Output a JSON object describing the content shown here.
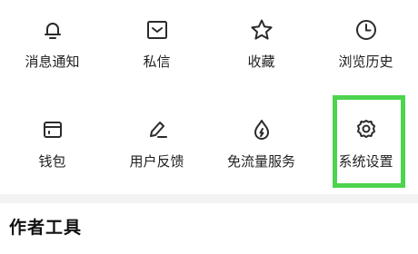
{
  "menu": {
    "row1": [
      {
        "label": "消息通知",
        "icon": "bell-icon"
      },
      {
        "label": "私信",
        "icon": "message-icon"
      },
      {
        "label": "收藏",
        "icon": "star-icon"
      },
      {
        "label": "浏览历史",
        "icon": "clock-icon"
      }
    ],
    "row2": [
      {
        "label": "钱包",
        "icon": "wallet-icon"
      },
      {
        "label": "用户反馈",
        "icon": "pen-icon"
      },
      {
        "label": "免流量服务",
        "icon": "flame-icon"
      },
      {
        "label": "系统设置",
        "icon": "gear-icon"
      }
    ]
  },
  "section": {
    "title": "作者工具"
  },
  "colors": {
    "highlight": "#4cd44f",
    "icon_stroke": "#2b2b2b",
    "divider": "#f3f3f3"
  }
}
